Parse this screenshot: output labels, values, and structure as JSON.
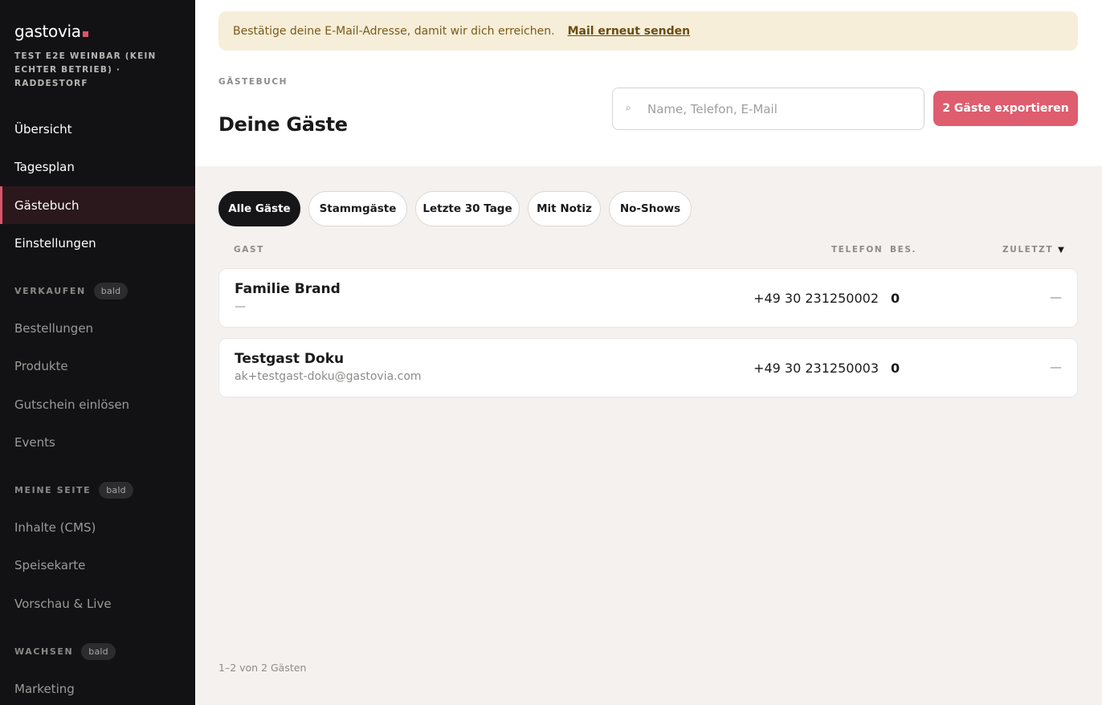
{
  "sidebar": {
    "brand": "gastovia",
    "venue": "TEST E2E WEINBAR (KEIN ECHTER BETRIEB) · RADDESTORF",
    "main_nav": [
      {
        "label": "Übersicht",
        "active": false
      },
      {
        "label": "Tagesplan",
        "active": false
      },
      {
        "label": "Gästebuch",
        "active": true
      },
      {
        "label": "Einstellungen",
        "active": false
      }
    ],
    "sections": [
      {
        "label": "VERKAUFEN",
        "badge": "bald",
        "items": [
          "Bestellungen",
          "Produkte",
          "Gutschein einlösen",
          "Events"
        ]
      },
      {
        "label": "MEINE SEITE",
        "badge": "bald",
        "items": [
          "Inhalte (CMS)",
          "Speisekarte",
          "Vorschau & Live"
        ]
      },
      {
        "label": "WACHSEN",
        "badge": "bald",
        "items": [
          "Marketing"
        ]
      }
    ]
  },
  "banner": {
    "text": "Bestätige deine E-Mail-Adresse, damit wir dich erreichen.",
    "link": "Mail erneut senden"
  },
  "header": {
    "eyebrow": "GÄSTEBUCH",
    "title": "Deine Gäste",
    "search_placeholder": "Name, Telefon, E-Mail",
    "export_label": "2 Gäste exportieren"
  },
  "filters": [
    {
      "label": "Alle Gäste",
      "active": true
    },
    {
      "label": "Stammgäste",
      "active": false
    },
    {
      "label": "Letzte 30 Tage",
      "active": false
    },
    {
      "label": "Mit Notiz",
      "active": false
    },
    {
      "label": "No-Shows",
      "active": false
    }
  ],
  "table": {
    "columns": {
      "guest": "GAST",
      "phone": "TELEFON",
      "visits": "BES.",
      "last": "ZULETZT",
      "sort_indicator": "▼"
    },
    "rows": [
      {
        "name": "Familie Brand",
        "sub": "—",
        "phone": "+49 30 231250002",
        "visits": "0",
        "last": "—"
      },
      {
        "name": "Testgast Doku",
        "sub": "ak+testgast-doku@gastovia.com",
        "phone": "+49 30 231250003",
        "visits": "0",
        "last": "—"
      }
    ]
  },
  "pagination": "1–2 von 2 Gästen",
  "colors": {
    "accent": "#de5d6e",
    "sidebar_bg": "#121214",
    "banner_bg": "#f6eed9",
    "page_bg": "#f4f1ef"
  },
  "icons": {
    "search": "search-icon"
  }
}
